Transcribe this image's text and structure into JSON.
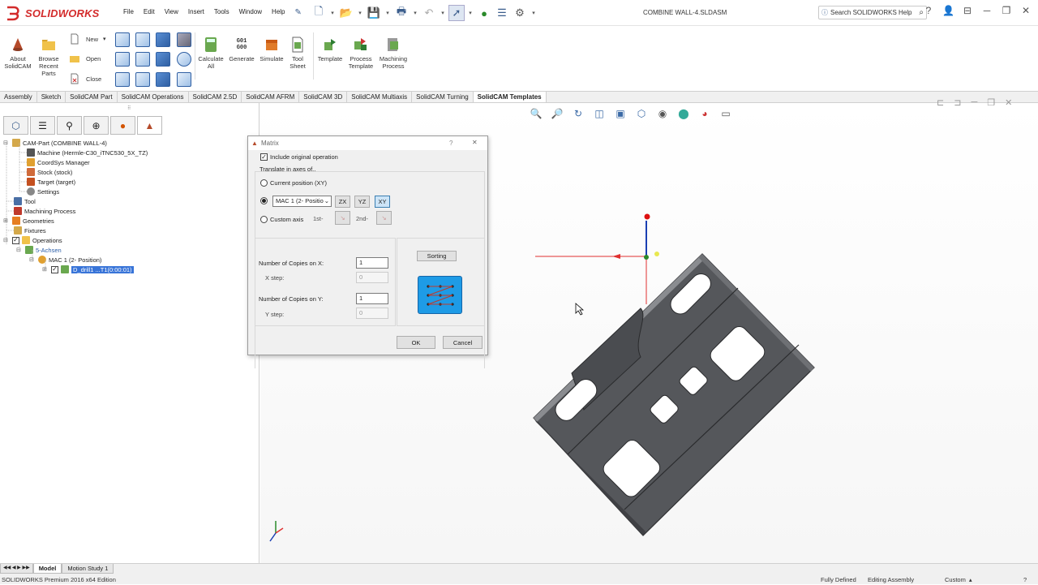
{
  "app": {
    "brand": "SOLIDWORKS",
    "doc_title": "COMBINE WALL-4.SLDASM",
    "search_placeholder": "Search SOLIDWORKS Help"
  },
  "menu": [
    "File",
    "Edit",
    "View",
    "Insert",
    "Tools",
    "Window",
    "Help"
  ],
  "ribbon": {
    "about": "About SolidCAM",
    "browse": "Browse Recent Parts",
    "new": "New",
    "open": "Open",
    "close": "Close",
    "calculate": "Calculate All",
    "generate": "Generate",
    "simulate": "Simulate",
    "toolsheet": "Tool Sheet",
    "template": "Template",
    "process_template": "Process Template",
    "machining_process": "Machining Process",
    "gcode_icon": "G01 G00"
  },
  "tabs": [
    "Assembly",
    "Sketch",
    "SolidCAM Part",
    "SolidCAM Operations",
    "SolidCAM 2.5D",
    "SolidCAM AFRM",
    "SolidCAM 3D",
    "SolidCAM Multiaxis",
    "SolidCAM Turning",
    "SolidCAM Templates"
  ],
  "active_tab": "SolidCAM Templates",
  "tree": {
    "cam_part": "CAM-Part (COMBINE WALL-4)",
    "machine": "Machine (Hermle-C30_iTNC530_5X_TZ)",
    "coordsys": "CoordSys Manager",
    "stock": "Stock (stock)",
    "target": "Target (target)",
    "settings": "Settings",
    "tool": "Tool",
    "machining_process": "Machining Process",
    "geometries": "Geometries",
    "fixtures": "Fixtures",
    "operations": "Operations",
    "achsen": "5-Achsen",
    "mac": "MAC 1 (2- Position)",
    "drill": "D_drill1 ...T1(0:00:01)"
  },
  "dialog": {
    "title": "Matrix",
    "help": "?",
    "close": "✕",
    "include_original": "Include original operation",
    "translate_label": "Translate in axes of..",
    "current_position": "Current position (XY)",
    "mac_select": "MAC 1 (2- Positio",
    "zx": "ZX",
    "yz": "YZ",
    "xy": "XY",
    "custom_axis": "Custom axis",
    "first": "1st-",
    "second": "2nd-",
    "copies_x_label": "Number of Copies on X:",
    "copies_x_value": "1",
    "x_step_label": "X step:",
    "x_step_value": "0",
    "copies_y_label": "Number of Copies on Y:",
    "copies_y_value": "1",
    "y_step_label": "Y step:",
    "y_step_value": "0",
    "sorting": "Sorting",
    "ok": "OK",
    "cancel": "Cancel"
  },
  "bottom_tabs": [
    "Model",
    "Motion Study 1"
  ],
  "status": {
    "edition": "SOLIDWORKS Premium 2016 x64 Edition",
    "defined": "Fully Defined",
    "editing": "Editing Assembly",
    "units": "Custom"
  },
  "colors": {
    "accent": "#3874d8",
    "brand_red": "#d32b2b",
    "part_gray": "#5a5c60",
    "sorting_blue": "#1e9be6"
  }
}
